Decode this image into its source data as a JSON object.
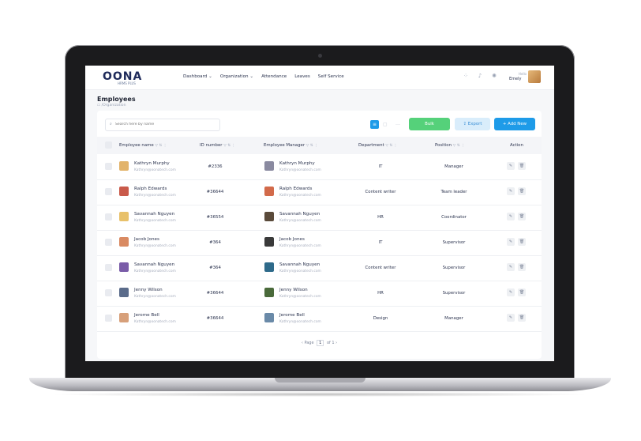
{
  "app": {
    "logo": "OONA",
    "logo_sub": "HRMS PLUS",
    "nav": [
      {
        "label": "Dashboard",
        "chevron": true
      },
      {
        "label": "Organization",
        "chevron": true
      },
      {
        "label": "Attendance",
        "chevron": false
      },
      {
        "label": "Leaves",
        "chevron": false
      },
      {
        "label": "Self Service",
        "chevron": false
      }
    ],
    "user": {
      "greeting": "Hello",
      "name": "Emely"
    }
  },
  "page": {
    "title": "Employees",
    "breadcrumb": "☖ /Organization"
  },
  "toolbar": {
    "search_placeholder": "Search here by name",
    "bulk_label": "Bulk",
    "export_label": "Export",
    "add_label": "+ Add New"
  },
  "table": {
    "columns": [
      "Employee name",
      "ID number",
      "Employee Manager",
      "Department",
      "Position",
      "Action"
    ],
    "rows": [
      {
        "name": "Kathryn Murphy",
        "email": "Kathryn@oonatech.com",
        "id": "#2336",
        "manager": "Kathryn Murphy",
        "manager_email": "Kathryn@oonatech.com",
        "department": "IT",
        "position": "Manager"
      },
      {
        "name": "Ralph Edwards",
        "email": "Kathryn@oonatech.com",
        "id": "#36644",
        "manager": "Ralph Edwards",
        "manager_email": "Kathryn@oonatech.com",
        "department": "Content writer",
        "position": "Team leader"
      },
      {
        "name": "Savannah Nguyen",
        "email": "Kathryn@oonatech.com",
        "id": "#36554",
        "manager": "Savannah Nguyen",
        "manager_email": "Kathryn@oonatech.com",
        "department": "HR",
        "position": "Coordinator"
      },
      {
        "name": "Jacob Jones",
        "email": "Kathryn@oonatech.com",
        "id": "#364",
        "manager": "Jacob Jones",
        "manager_email": "Kathryn@oonatech.com",
        "department": "IT",
        "position": "Supervisor"
      },
      {
        "name": "Savannah Nguyen",
        "email": "Kathryn@oonatech.com",
        "id": "#364",
        "manager": "Savannah Nguyen",
        "manager_email": "Kathryn@oonatech.com",
        "department": "Content writer",
        "position": "Supervisor"
      },
      {
        "name": "Jenny Wilson",
        "email": "Kathryn@oonatech.com",
        "id": "#36644",
        "manager": "Jenny Wilson",
        "manager_email": "Kathryn@oonatech.com",
        "department": "HR",
        "position": "Supervisor"
      },
      {
        "name": "Jerome Bell",
        "email": "Kathryn@oonatech.com",
        "id": "#36644",
        "manager": "Jerome Bell",
        "manager_email": "Kathryn@oonatech.com",
        "department": "Design",
        "position": "Manager"
      }
    ]
  },
  "pagination": {
    "prev": "‹",
    "page_label": "Page",
    "current": "1",
    "of_label": "of 1",
    "next": "›"
  },
  "colors": {
    "accent": "#1e9be8",
    "bulk": "#55d17a",
    "export_bg": "#d9edfb"
  }
}
